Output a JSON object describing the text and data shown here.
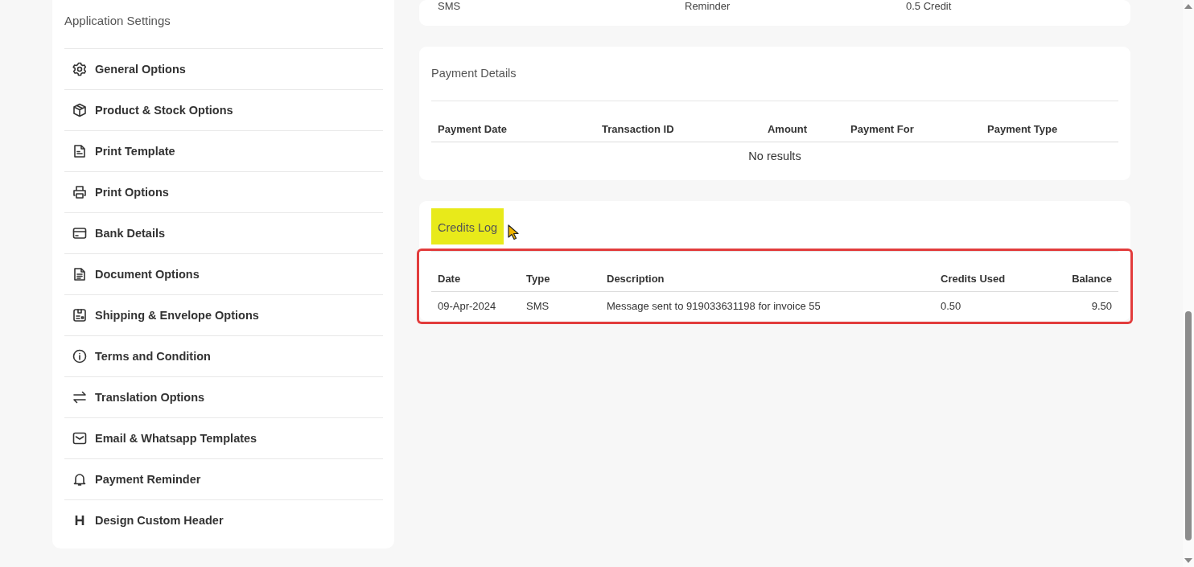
{
  "sidebar": {
    "title": "Application Settings",
    "items": [
      {
        "label": "General Options"
      },
      {
        "label": "Product & Stock Options"
      },
      {
        "label": "Print Template"
      },
      {
        "label": "Print Options"
      },
      {
        "label": "Bank Details"
      },
      {
        "label": "Document Options"
      },
      {
        "label": "Shipping & Envelope Options"
      },
      {
        "label": "Terms and Condition"
      },
      {
        "label": "Translation Options"
      },
      {
        "label": "Email & Whatsapp Templates"
      },
      {
        "label": "Payment Reminder"
      },
      {
        "label": "Design Custom Header"
      }
    ]
  },
  "pricing_table": {
    "rows": [
      [
        "SMS",
        "Reminder",
        "0.5 Credit"
      ]
    ]
  },
  "payment_details": {
    "title": "Payment Details",
    "columns": [
      "Payment Date",
      "Transaction ID",
      "Amount",
      "Payment For",
      "Payment Type"
    ],
    "empty_text": "No results"
  },
  "credits_log": {
    "title": "Credits Log",
    "highlighted": true,
    "outlined": true,
    "columns": [
      "Date",
      "Type",
      "Description",
      "Credits Used",
      "Balance"
    ],
    "rows": [
      [
        "09-Apr-2024",
        "SMS",
        "Message sent to 919033631198 for invoice 55",
        "0.50",
        "9.50"
      ]
    ]
  }
}
